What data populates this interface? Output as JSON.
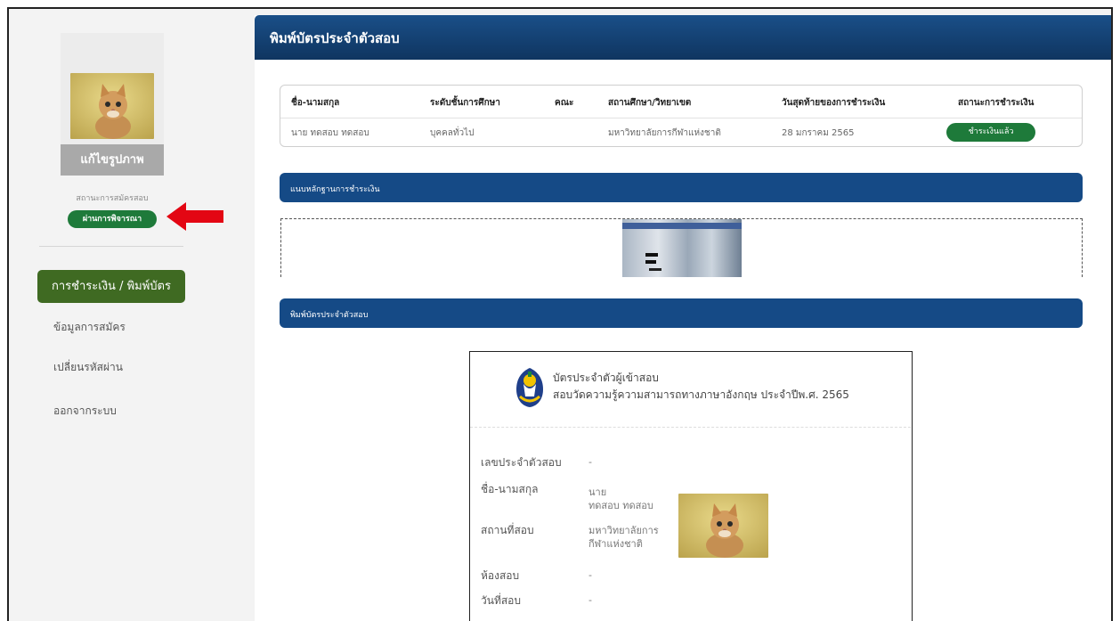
{
  "sidebar": {
    "edit_photo_label": "แก้ไขรูปภาพ",
    "status_label": "สถานะการสมัครสอบ",
    "status_value": "ผ่านการพิจารณา",
    "menu": {
      "active": "การชำระเงิน / พิมพ์บัตร",
      "items": [
        "ข้อมูลการสมัคร",
        "เปลี่ยนรหัสผ่าน",
        "ออกจากระบบ"
      ]
    }
  },
  "main": {
    "title": "พิมพ์บัตรประจำตัวสอบ",
    "table": {
      "headers": [
        "ชื่อ-นามสกุล",
        "ระดับชั้นการศึกษา",
        "คณะ",
        "สถานศึกษา/วิทยาเขต",
        "วันสุดท้ายของการชำระเงิน",
        "สถานะการชำระเงิน"
      ],
      "row": {
        "name": "นาย ทดสอบ ทดสอบ",
        "level": "บุคคลทั่วไป",
        "faculty": "",
        "school": "มหาวิทยาลัยการกีฬาแห่งชาติ",
        "deadline": "28 มกราคม 2565",
        "payment_status": "ชำระเงินแล้ว"
      }
    },
    "evidence_section": "แนบหลักฐานการชำระเงิน",
    "print_section": "พิมพ์บัตรประจำตัวสอบ",
    "card": {
      "title1": "บัตรประจำตัวผู้เข้าสอบ",
      "title2": "สอบวัดความรู้ความสามารถทางภาษาอังกฤษ ประจำปีพ.ศ. 2565",
      "fields": [
        {
          "label": "เลขประจำตัวสอบ",
          "value": "-"
        },
        {
          "label": "ชื่อ-นามสกุล",
          "value1": "นาย",
          "value2": "ทดสอบ ทดสอบ"
        },
        {
          "label": "สถานที่สอบ",
          "value1": "มหาวิทยาลัยการ",
          "value2": "กีฬาแห่งชาติ"
        },
        {
          "label": "ห้องสอบ",
          "value": "-"
        },
        {
          "label": "วันที่สอบ",
          "value": "-"
        }
      ]
    }
  },
  "icons": {
    "arrow": "left-arrow-icon",
    "emblem": "university-emblem-icon",
    "arrow_color": "#e30613"
  }
}
